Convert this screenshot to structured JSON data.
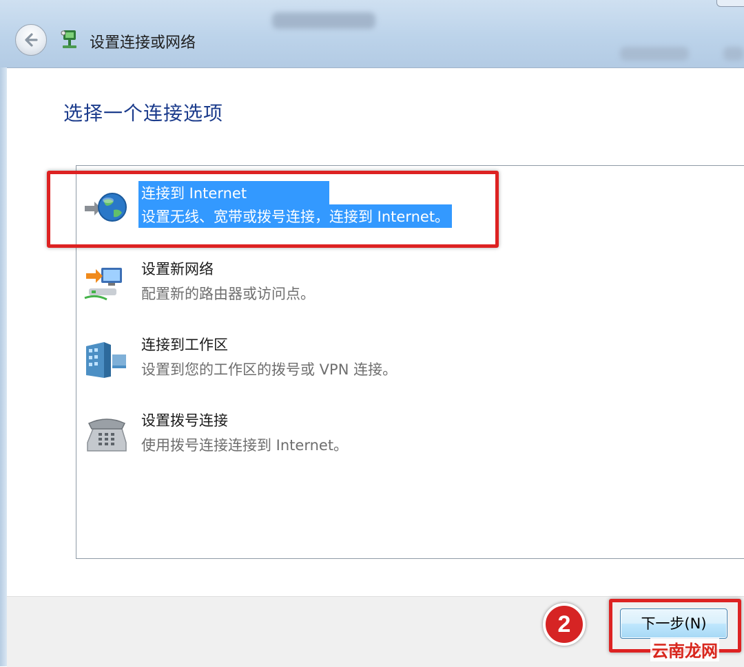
{
  "window": {
    "title": "设置连接或网络",
    "back_icon": "back-arrow-icon",
    "app_icon": "network-setup-icon"
  },
  "heading": "选择一个连接选项",
  "options": [
    {
      "title": "连接到 Internet",
      "description": "设置无线、宽带或拨号连接，连接到 Internet。",
      "icon": "globe-icon",
      "selected": true
    },
    {
      "title": "设置新网络",
      "description": "配置新的路由器或访问点。",
      "icon": "new-network-icon",
      "selected": false
    },
    {
      "title": "连接到工作区",
      "description": "设置到您的工作区的拨号或 VPN 连接。",
      "icon": "workplace-icon",
      "selected": false
    },
    {
      "title": "设置拨号连接",
      "description": "使用拨号连接连接到 Internet。",
      "icon": "dialup-phone-icon",
      "selected": false
    }
  ],
  "annotations": {
    "step_badge": "2",
    "highlight_color": "#dd2222"
  },
  "footer": {
    "next_label": "下一步(N)"
  },
  "watermark": "云南龙网",
  "colors": {
    "heading": "#1c3c8c",
    "selection": "#3399ff"
  }
}
